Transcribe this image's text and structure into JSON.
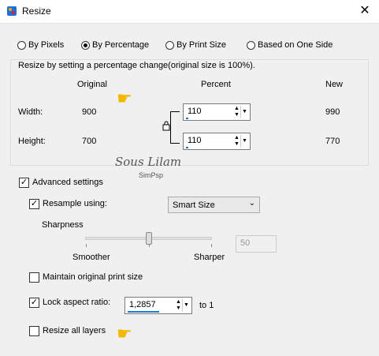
{
  "window": {
    "title": "Resize",
    "close_glyph": "✕",
    "app_icon": "paintshop-icon"
  },
  "mode_options": [
    {
      "label": "By Pixels",
      "checked": false
    },
    {
      "label": "By Percentage",
      "checked": true
    },
    {
      "label": "By Print Size",
      "checked": false
    },
    {
      "label": "Based on One Side",
      "checked": false
    }
  ],
  "group": {
    "caption": "Resize by setting a percentage change(original size is 100%).",
    "col_original": "Original",
    "col_percent": "Percent",
    "col_new": "New",
    "width_label": "Width:",
    "height_label": "Height:",
    "width_original": "900",
    "height_original": "700",
    "width_percent": "110",
    "height_percent": "110",
    "width_new": "990",
    "height_new": "770"
  },
  "watermark": {
    "name": "Sous Lilam",
    "sub": "SimPsp"
  },
  "advanced": {
    "advanced_label": "Advanced settings",
    "advanced_checked": true,
    "resample_label": "Resample using:",
    "resample_checked": true,
    "resample_value": "Smart Size",
    "sharpness_label": "Sharpness",
    "smoother_label": "Smoother",
    "sharper_label": "Sharper",
    "sharpness_value": "50",
    "maintain_label": "Maintain original print size",
    "maintain_checked": false,
    "lock_label": "Lock aspect ratio:",
    "lock_checked": true,
    "ratio_value": "1,2857",
    "to_label": "to 1",
    "resize_layers_label": "Resize all layers",
    "resize_layers_checked": false
  },
  "glyphs": {
    "check": "✓",
    "up": "▲",
    "down": "▼",
    "drop": "▼",
    "chev": "⌄",
    "hand": "☛",
    "lock": "🔒"
  }
}
